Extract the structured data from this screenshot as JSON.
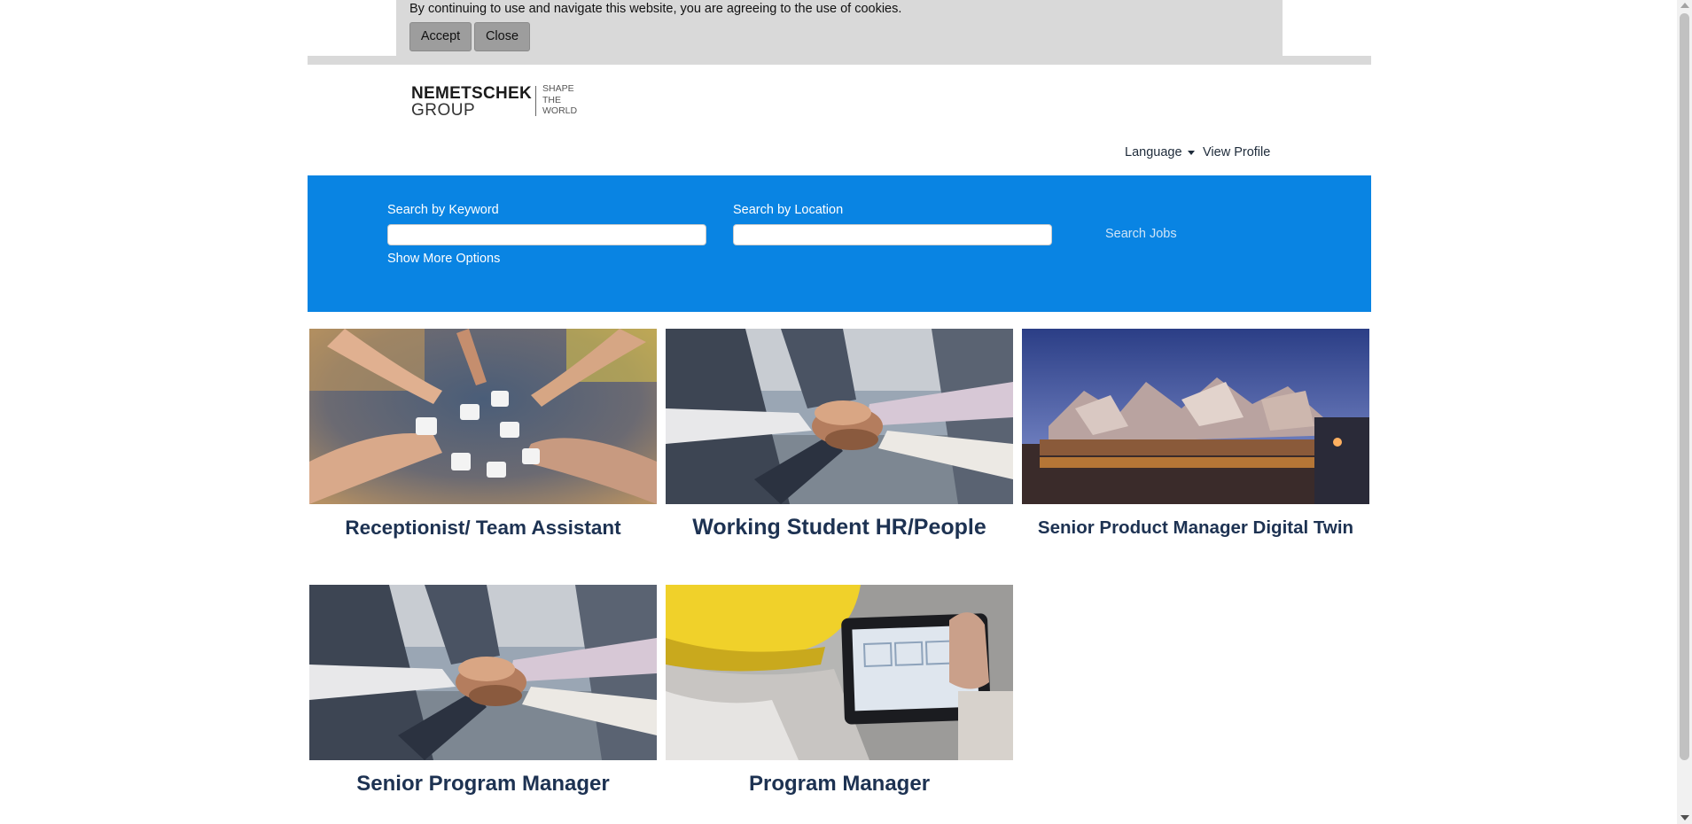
{
  "cookie": {
    "message": "By continuing to use and navigate this website, you are agreeing to the use of cookies.",
    "accept_label": "Accept",
    "close_label": "Close"
  },
  "logo": {
    "name": "NEMETSCHEK",
    "group": "GROUP",
    "tagline": [
      "SHAPE",
      "THE",
      "WORLD"
    ]
  },
  "header": {
    "language_label": "Language",
    "profile_label": "View Profile"
  },
  "search": {
    "keyword_label": "Search by Keyword",
    "keyword_value": "",
    "location_label": "Search by Location",
    "location_value": "",
    "more_options_label": "Show More Options",
    "submit_label": "Search Jobs"
  },
  "jobs": [
    {
      "title": "Receptionist/ Team Assistant",
      "image": "puzzle-hands-photo"
    },
    {
      "title": "Working Student HR/People",
      "image": "team-hands-stack-photo"
    },
    {
      "title": "Senior Product Manager Digital Twin",
      "image": "building-at-dusk-photo"
    },
    {
      "title": "Senior Program Manager",
      "image": "team-hands-stack-photo"
    },
    {
      "title": "Program Manager",
      "image": "hardhat-tablet-photo"
    }
  ],
  "colors": {
    "accent": "#0984e3",
    "title": "#1d3252",
    "cookie_bg": "#d9d9d9"
  }
}
